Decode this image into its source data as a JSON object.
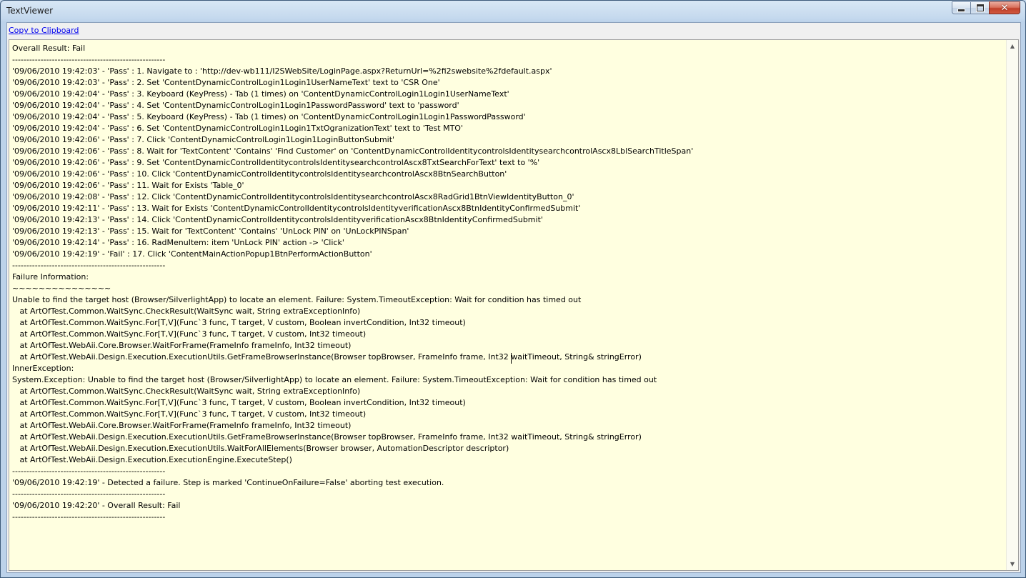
{
  "window": {
    "title": "TextViewer",
    "close_glyph": "✕",
    "buttons": [
      "minimize-icon",
      "maximize-icon",
      "close-icon"
    ]
  },
  "toolbar": {
    "copy_label": "Copy to Clipboard"
  },
  "colors": {
    "text_background": "#ffffe0",
    "link": "#0000ee"
  },
  "scrollbar": {
    "up_arrow": "▲",
    "down_arrow": "▼"
  },
  "lines": [
    "Overall Result: Fail",
    "------------------------------------------------------",
    "'09/06/2010 19:42:03' - 'Pass' : 1. Navigate to : 'http://dev-wb111/I2SWebSite/LoginPage.aspx?ReturnUrl=%2fi2swebsite%2fdefault.aspx'",
    "'09/06/2010 19:42:03' - 'Pass' : 2. Set 'ContentDynamicControlLogin1Login1UserNameText' text to 'CSR One'",
    "'09/06/2010 19:42:04' - 'Pass' : 3. Keyboard (KeyPress) - Tab (1 times) on 'ContentDynamicControlLogin1Login1UserNameText'",
    "'09/06/2010 19:42:04' - 'Pass' : 4. Set 'ContentDynamicControlLogin1Login1PasswordPassword' text to 'password'",
    "'09/06/2010 19:42:04' - 'Pass' : 5. Keyboard (KeyPress) - Tab (1 times) on 'ContentDynamicControlLogin1Login1PasswordPassword'",
    "'09/06/2010 19:42:04' - 'Pass' : 6. Set 'ContentDynamicControlLogin1Login1TxtOgranizationText' text to 'Test MTO'",
    "'09/06/2010 19:42:06' - 'Pass' : 7. Click 'ContentDynamicControlLogin1Login1LoginButtonSubmit'",
    "'09/06/2010 19:42:06' - 'Pass' : 8. Wait for 'TextContent' 'Contains' 'Find Customer' on 'ContentDynamicControlIdentitycontrolsIdentitysearchcontrolAscx8LblSearchTitleSpan'",
    "'09/06/2010 19:42:06' - 'Pass' : 9. Set 'ContentDynamicControlIdentitycontrolsIdentitysearchcontrolAscx8TxtSearchForText' text to '%'",
    "'09/06/2010 19:42:06' - 'Pass' : 10. Click 'ContentDynamicControlIdentitycontrolsIdentitysearchcontrolAscx8BtnSearchButton'",
    "'09/06/2010 19:42:06' - 'Pass' : 11. Wait for Exists 'Table_0'",
    "'09/06/2010 19:42:08' - 'Pass' : 12. Click 'ContentDynamicControlIdentitycontrolsIdentitysearchcontrolAscx8RadGrid1BtnViewIdentityButton_0'",
    "'09/06/2010 19:42:11' - 'Pass' : 13. Wait for Exists 'ContentDynamicControlIdentitycontrolsIdentityverificationAscx8BtnIdentityConfirmedSubmit'",
    "'09/06/2010 19:42:13' - 'Pass' : 14. Click 'ContentDynamicControlIdentitycontrolsIdentityverificationAscx8BtnIdentityConfirmedSubmit'",
    "'09/06/2010 19:42:13' - 'Pass' : 15. Wait for 'TextContent' 'Contains' 'UnLock PIN' on 'UnLockPINSpan'",
    "'09/06/2010 19:42:14' - 'Pass' : 16. RadMenuItem: item 'UnLock PIN' action -> 'Click'",
    "'09/06/2010 19:42:19' - 'Fail' : 17. Click 'ContentMainActionPopup1BtnPerformActionButton'",
    "------------------------------------------------------",
    "Failure Information:",
    "~~~~~~~~~~~~~~~",
    "Unable to find the target host (Browser/SilverlightApp) to locate an element. Failure: System.TimeoutException: Wait for condition has timed out",
    "   at ArtOfTest.Common.WaitSync.CheckResult(WaitSync wait, String extraExceptionInfo)",
    "   at ArtOfTest.Common.WaitSync.For[T,V](Func`3 func, T target, V custom, Boolean invertCondition, Int32 timeout)",
    "   at ArtOfTest.Common.WaitSync.For[T,V](Func`3 func, T target, V custom, Int32 timeout)",
    "   at ArtOfTest.WebAii.Core.Browser.WaitForFrame(FrameInfo frameInfo, Int32 timeout)",
    "   at ArtOfTest.WebAii.Design.Execution.ExecutionUtils.GetFrameBrowserInstance(Browser topBrowser, FrameInfo frame, Int32 waitTimeout, String& stringError)",
    "InnerException:",
    "System.Exception: Unable to find the target host (Browser/SilverlightApp) to locate an element. Failure: System.TimeoutException: Wait for condition has timed out",
    "   at ArtOfTest.Common.WaitSync.CheckResult(WaitSync wait, String extraExceptionInfo)",
    "   at ArtOfTest.Common.WaitSync.For[T,V](Func`3 func, T target, V custom, Boolean invertCondition, Int32 timeout)",
    "   at ArtOfTest.Common.WaitSync.For[T,V](Func`3 func, T target, V custom, Int32 timeout)",
    "   at ArtOfTest.WebAii.Core.Browser.WaitForFrame(FrameInfo frameInfo, Int32 timeout)",
    "   at ArtOfTest.WebAii.Design.Execution.ExecutionUtils.GetFrameBrowserInstance(Browser topBrowser, FrameInfo frame, Int32 waitTimeout, String& stringError)",
    "   at ArtOfTest.WebAii.Design.Execution.ExecutionUtils.WaitForAllElements(Browser browser, AutomationDescriptor descriptor)",
    "   at ArtOfTest.WebAii.Design.Execution.ExecutionEngine.ExecuteStep()",
    "------------------------------------------------------",
    "'09/06/2010 19:42:19' - Detected a failure. Step is marked 'ContinueOnFailure=False' aborting test execution.",
    "------------------------------------------------------",
    "'09/06/2010 19:42:20' - Overall Result: Fail",
    "------------------------------------------------------"
  ]
}
